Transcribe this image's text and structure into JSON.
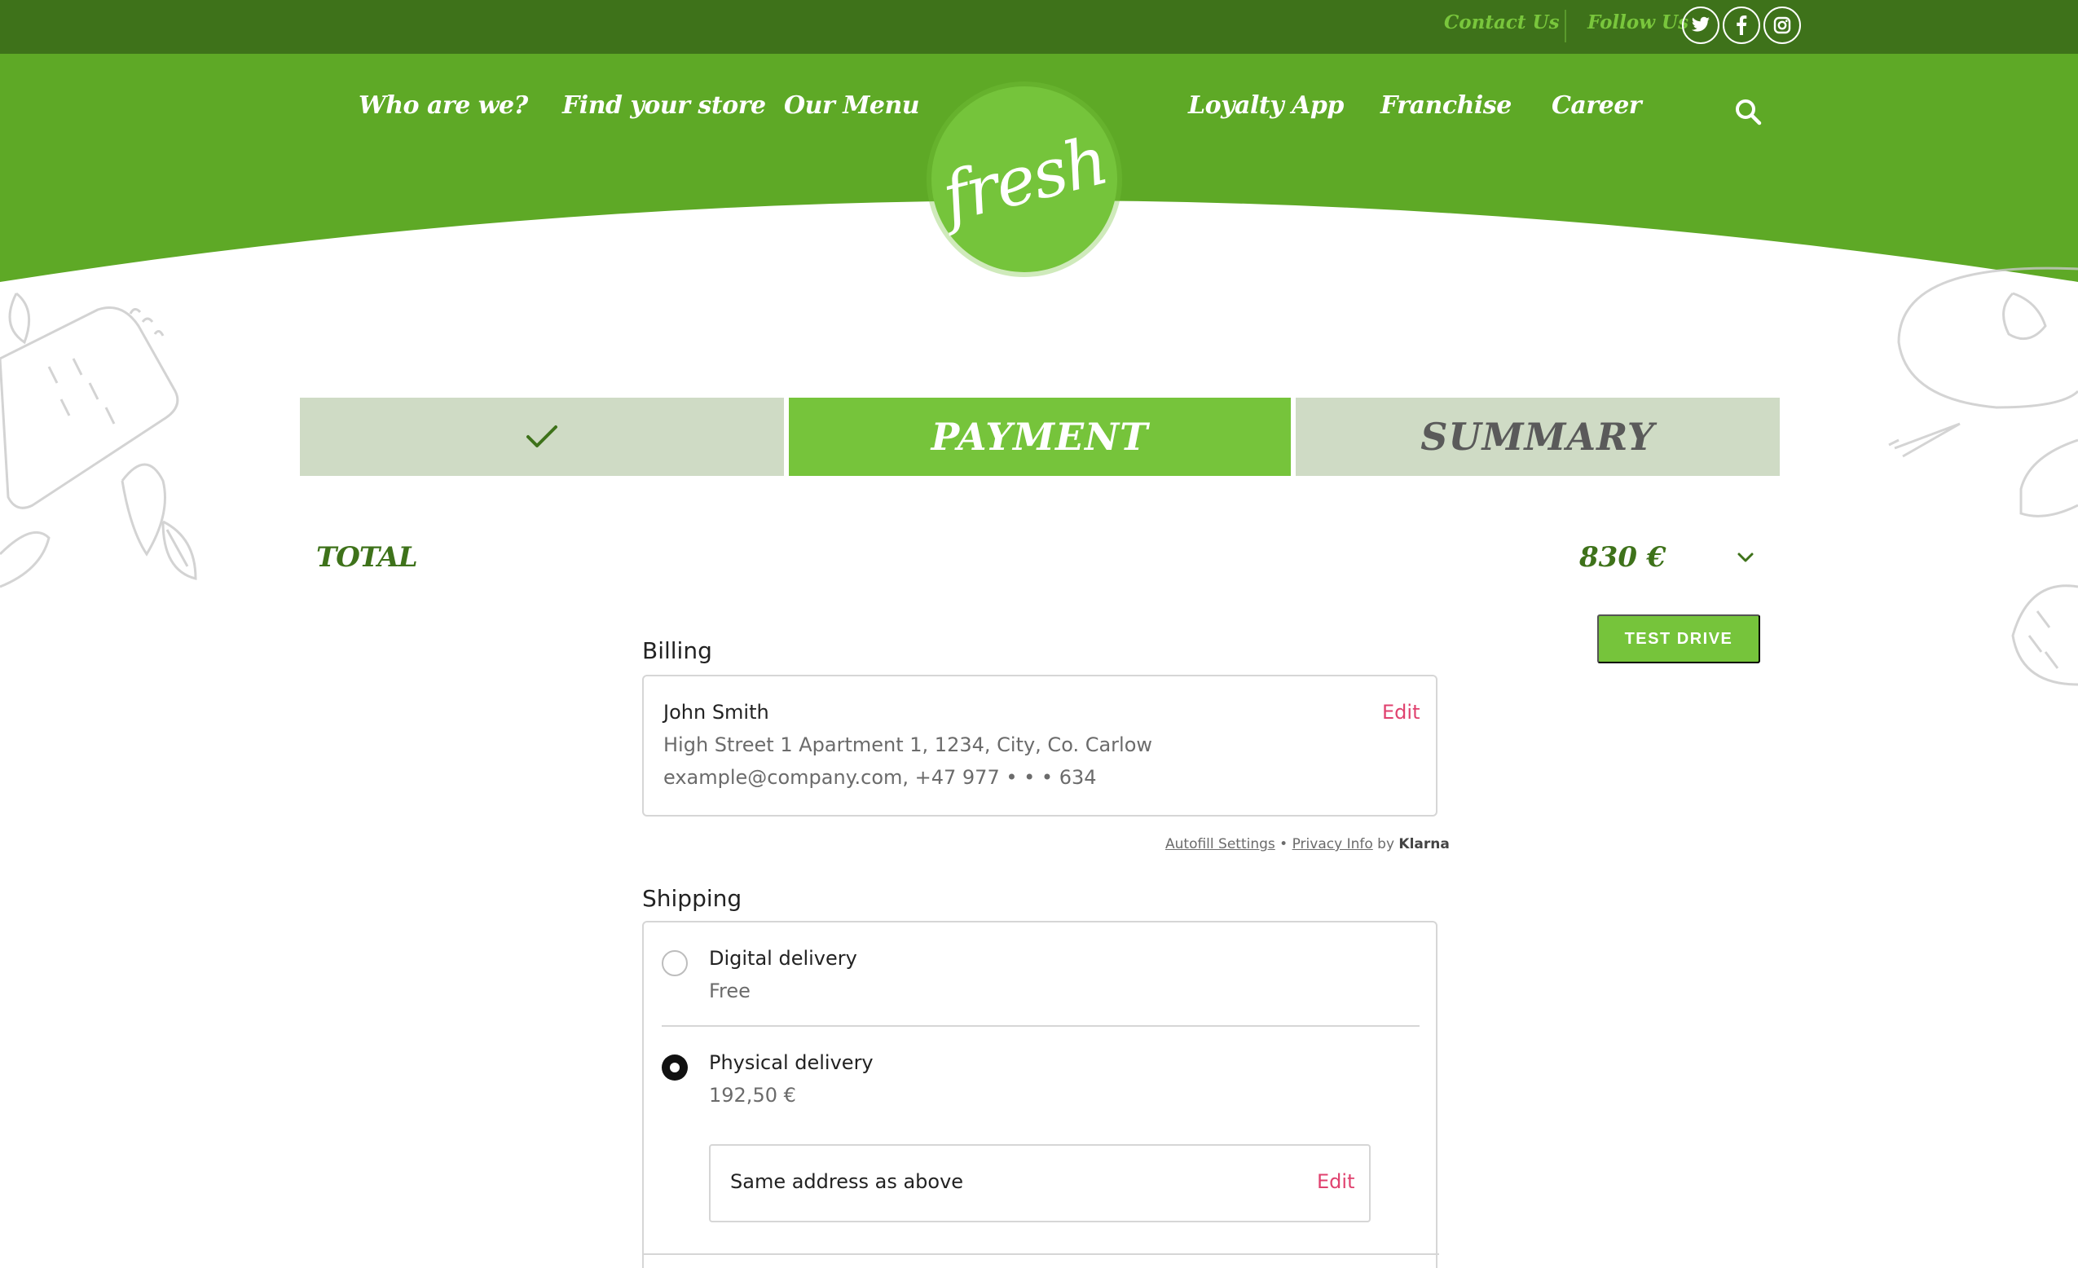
{
  "colors": {
    "dark_green": "#3e721a",
    "brand_green": "#5ea926",
    "light_green": "#76c43b",
    "step_inactive": "#cfdbc5",
    "edit_pink": "#e0426f"
  },
  "topbar": {
    "contact_label": "Contact Us",
    "follow_label": "Follow Us",
    "social": [
      "twitter-icon",
      "facebook-icon",
      "instagram-icon"
    ]
  },
  "nav": {
    "left": [
      "Who are we?",
      "Find your store",
      "Our Menu"
    ],
    "right": [
      "Loyalty App",
      "Franchise",
      "Career"
    ],
    "logo_text": "fresh",
    "search_icon": "search-icon"
  },
  "steps": {
    "done_icon": "checkmark-icon",
    "payment_label": "PAYMENT",
    "summary_label": "SUMMARY"
  },
  "total": {
    "label": "TOTAL",
    "value": "830 €",
    "toggle_icon": "chevron-down-icon"
  },
  "test_drive_label": "TEST DRIVE",
  "billing": {
    "title": "Billing",
    "name": "John Smith",
    "address": "High Street 1 Apartment 1, 1234, City, Co. Carlow",
    "contact": "example@company.com, +47 977  • • • 634",
    "edit_label": "Edit"
  },
  "autofill": {
    "settings": "Autofill Settings",
    "separator": " • ",
    "privacy": "Privacy Info",
    "by": " by ",
    "provider": "Klarna"
  },
  "shipping": {
    "title": "Shipping",
    "options": [
      {
        "title": "Digital delivery",
        "price": "Free",
        "selected": false
      },
      {
        "title": "Physical delivery",
        "price": "192,50 €",
        "selected": true
      }
    ],
    "address_label": "Same address as above",
    "edit_label": "Edit"
  }
}
